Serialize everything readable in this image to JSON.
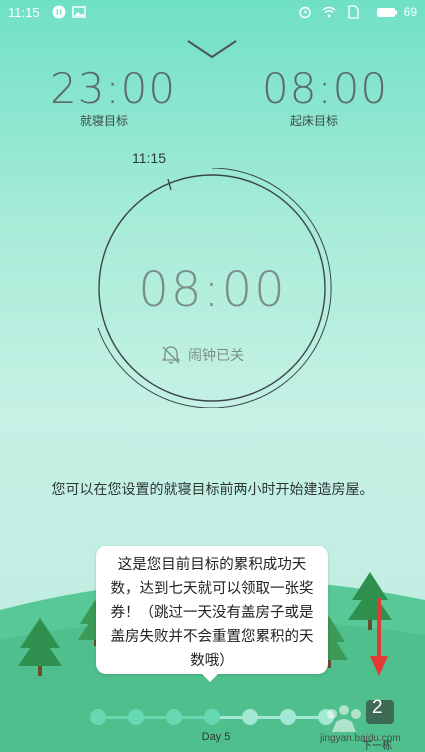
{
  "status_bar": {
    "time": "11:15",
    "battery": "69"
  },
  "bedtime": {
    "time": "23:00",
    "label": "就寝目标"
  },
  "wakeup": {
    "time": "08:00",
    "label": "起床目标"
  },
  "clock": {
    "marker_time": "11:15",
    "center_time": "08:00",
    "alarm_status": "闹钟已关"
  },
  "hint": {
    "text": "您可以在您设置的就寝目标前两小时开始建造房屋。"
  },
  "tooltip": {
    "text": "这是您目前目标的累积成功天数，达到七天就可以领取一张奖券！（跳过一天没有盖房子或是盖房失败并不会重置您累积的天数哦）"
  },
  "progress": {
    "day_label": "Day 5",
    "completed_days": 5,
    "total_days": 7
  },
  "next": {
    "count": "2",
    "label": "下一栋"
  },
  "watermark": {
    "text": "jingyan.baidu.com"
  },
  "colors": {
    "accent": "#66d9b3",
    "arrow": "#e53935"
  }
}
